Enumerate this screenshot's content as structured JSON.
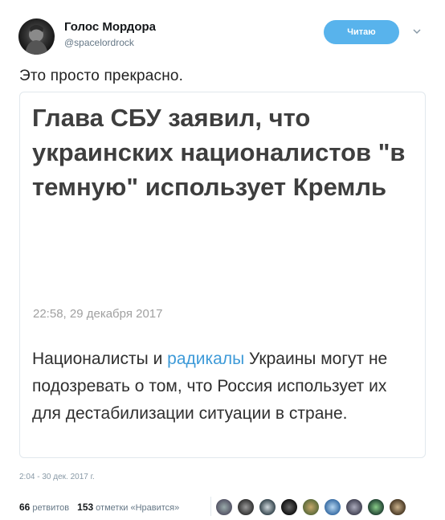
{
  "user": {
    "name": "Голос Мордора",
    "handle": "@spacelordrock",
    "follow_label": "Читаю"
  },
  "tweet": {
    "text": "Это просто прекрасно.",
    "timestamp": "2:04 - 30 дек. 2017 г."
  },
  "card": {
    "headline": "Глава СБУ заявил, что украинских националистов \"в темную\" использует Кремль",
    "date": "22:58, 29 декабря 2017",
    "body_before": "Националисты и ",
    "body_link": "радикалы",
    "body_after": " Украины могут не подозревать о том, что Россия использует их для дестабилизации ситуации в стране."
  },
  "stats": {
    "retweets_count": "66",
    "retweets_label": "ретвитов",
    "likes_count": "153",
    "likes_label": "отметки «Нравится»"
  },
  "colors": {
    "follow_button": "#58b3ec",
    "link": "#3d9ad8",
    "headline": "#3e3e3e"
  },
  "icons": {
    "caret": "chevron-down-icon"
  }
}
